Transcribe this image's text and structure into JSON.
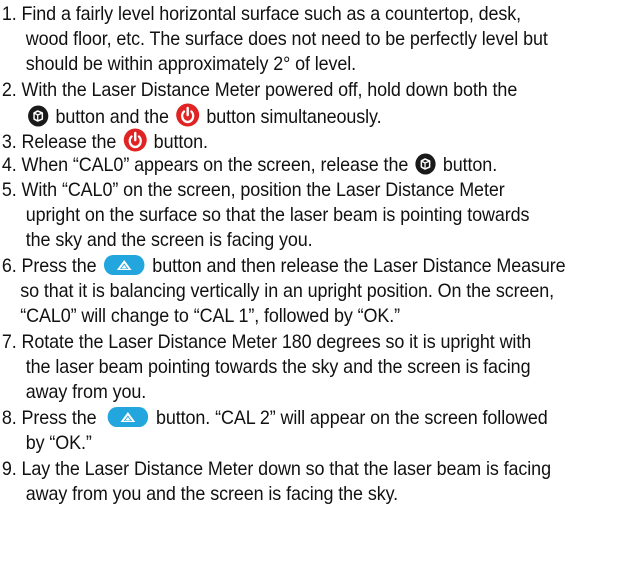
{
  "steps": [
    {
      "num": "1.",
      "lines": [
        "Find a fairly level horizontal surface such as a countertop, desk,",
        "wood floor, etc. The surface does not need to be perfectly level but",
        "should be within approximately 2° of level."
      ]
    },
    {
      "num": "2.",
      "line1": "With the Laser Distance Meter powered off, hold down both the",
      "line2_mid": "button and the",
      "line2_end": "button simultaneously."
    },
    {
      "num": "3.",
      "pre": "Release the",
      "post": "button."
    },
    {
      "num": "4.",
      "pre": "When “CAL0” appears on the screen, release the",
      "post": "button."
    },
    {
      "num": "5.",
      "lines": [
        "With “CAL0” on the screen, position the Laser Distance Meter",
        "upright on the surface so that the laser beam is pointing towards",
        "the sky and the screen is facing you."
      ]
    },
    {
      "num": "6.",
      "pre": "Press the",
      "post": "button and then release the Laser Distance Measure",
      "lines": [
        "so that it is balancing vertically in an upright position. On the screen,",
        "“CAL0” will change to “CAL 1”, followed by “OK.”"
      ]
    },
    {
      "num": "7.",
      "lines": [
        "Rotate the Laser Distance Meter 180 degrees so it is upright with",
        "the laser beam pointing towards the sky and the screen is facing",
        "away from you."
      ]
    },
    {
      "num": "8.",
      "pre": "Press the",
      "post": "button. “CAL 2” will appear on the screen followed",
      "line2": "by “OK.”"
    },
    {
      "num": "9.",
      "lines": [
        "Lay the Laser Distance Meter down so that the laser beam is facing",
        "away from you and the screen is facing the sky."
      ]
    }
  ],
  "icons": {
    "power_color": "#e02424",
    "cube_color": "#1a1a1a",
    "arrow_color": "#22a6dd"
  }
}
